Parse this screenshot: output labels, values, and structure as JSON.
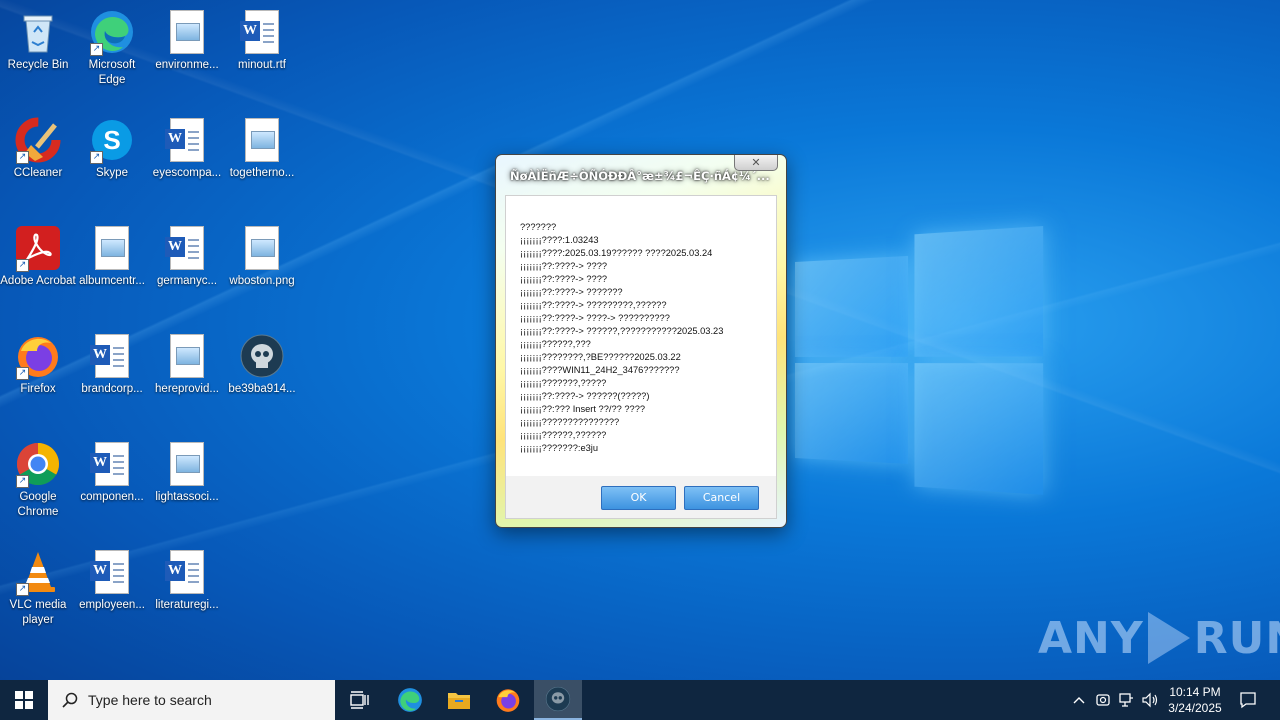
{
  "desktop": {
    "icons": [
      {
        "label": "Recycle Bin"
      },
      {
        "label": "Microsoft Edge"
      },
      {
        "label": "environme..."
      },
      {
        "label": "minout.rtf"
      },
      {
        "label": "CCleaner"
      },
      {
        "label": "Skype"
      },
      {
        "label": "eyescompa..."
      },
      {
        "label": "togetherno..."
      },
      {
        "label": "Adobe Acrobat"
      },
      {
        "label": "albumcentr..."
      },
      {
        "label": "germanyc..."
      },
      {
        "label": "wboston.png"
      },
      {
        "label": "Firefox"
      },
      {
        "label": "brandcorp..."
      },
      {
        "label": "hereprovid..."
      },
      {
        "label": "be39ba914..."
      },
      {
        "label": "Google Chrome"
      },
      {
        "label": "componen..."
      },
      {
        "label": "lightassoci..."
      },
      {
        "label": "VLC media player"
      },
      {
        "label": "employeen..."
      },
      {
        "label": "literaturegi..."
      }
    ]
  },
  "dialog": {
    "title": "ÑøÀÌËñÆ÷ÒÑÓÐÐÂ°æ±¾£¬ÊÇ·ñÁ¢¼´...",
    "close_glyph": "✕",
    "lines": [
      "???????",
      "¡¡¡¡¡¡¡????:1.03243",
      "¡¡¡¡¡¡¡????:2025.03.19?????? ????2025.03.24",
      "¡¡¡¡¡¡¡??:????-> ????",
      "¡¡¡¡¡¡¡??:????-> ????",
      "¡¡¡¡¡¡¡??:????-> ???????",
      "¡¡¡¡¡¡¡??:????-> ?????????,??????",
      "¡¡¡¡¡¡¡??:????-> ????-> ??????????",
      "¡¡¡¡¡¡¡??:????-> ??????,???????????2025.03.23",
      "¡¡¡¡¡¡¡??????,???",
      "¡¡¡¡¡¡¡????????,?BE??????2025.03.22",
      "¡¡¡¡¡¡¡????WIN11_24H2_3476???????",
      "¡¡¡¡¡¡¡???????,?????",
      "¡¡¡¡¡¡¡??:????-> ??????(?????)",
      "¡¡¡¡¡¡¡??:??? Insert ??/?? ????",
      "¡¡¡¡¡¡¡???????????????",
      "¡¡¡¡¡¡¡??????,??????",
      "¡¡¡¡¡¡¡???????:e3ju"
    ],
    "ok_label": "OK",
    "cancel_label": "Cancel"
  },
  "watermark": "ANY RUN",
  "watermark_left": "ANY",
  "watermark_right": "RUN",
  "taskbar": {
    "search_placeholder": "Type here to search",
    "time": "10:14 PM",
    "date": "3/24/2025"
  }
}
